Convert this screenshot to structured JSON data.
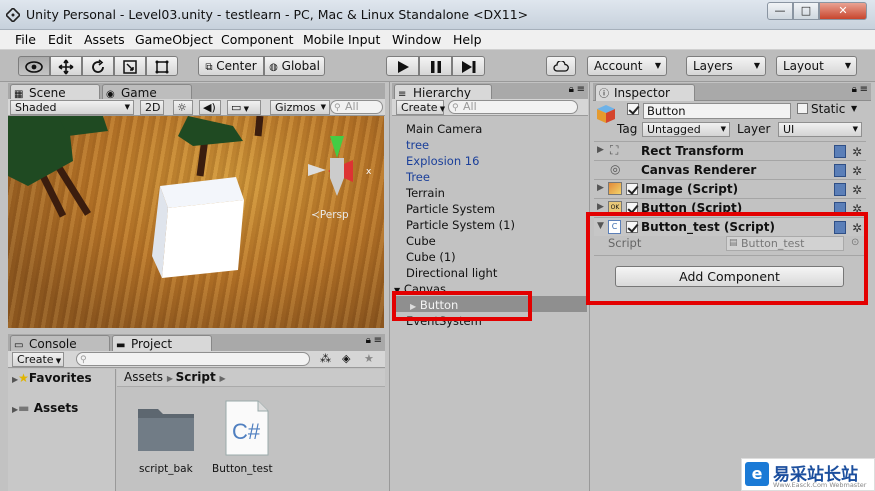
{
  "window": {
    "title": "Unity Personal - Level03.unity - testlearn - PC, Mac & Linux Standalone <DX11>",
    "min": "—",
    "max": "□",
    "close": "✕"
  },
  "menu": [
    "File",
    "Edit",
    "Assets",
    "GameObject",
    "Component",
    "Mobile Input",
    "Window",
    "Help"
  ],
  "toolbar": {
    "pivot": "Center",
    "space": "Global",
    "account": "Account",
    "layers": "Layers",
    "layout": "Layout"
  },
  "scene": {
    "tab_scene": "Scene",
    "tab_game": "Game",
    "shading": "Shaded",
    "mode_2d": "2D",
    "gizmos": "Gizmos",
    "search_placeholder": "All",
    "persp": "Persp",
    "axis_x": "x"
  },
  "hierarchy": {
    "tab": "Hierarchy",
    "create": "Create",
    "search_placeholder": "All",
    "items": [
      {
        "label": "Main Camera",
        "prefab": false
      },
      {
        "label": "tree",
        "prefab": true
      },
      {
        "label": "Explosion 16",
        "prefab": true
      },
      {
        "label": "Tree",
        "prefab": true
      },
      {
        "label": "Terrain",
        "prefab": false
      },
      {
        "label": "Particle System",
        "prefab": false
      },
      {
        "label": "Particle System (1)",
        "prefab": false
      },
      {
        "label": "Cube",
        "prefab": false
      },
      {
        "label": "Cube (1)",
        "prefab": false
      },
      {
        "label": "Directional light",
        "prefab": false
      },
      {
        "label": "Canvas",
        "prefab": false
      },
      {
        "label": "Button",
        "prefab": false
      },
      {
        "label": "EventSystem",
        "prefab": false
      }
    ],
    "selected": "Button"
  },
  "inspector": {
    "tab": "Inspector",
    "object_name": "Button",
    "static_label": "Static",
    "tag_label": "Tag",
    "tag_value": "Untagged",
    "layer_label": "Layer",
    "layer_value": "UI",
    "components": [
      {
        "name": "Rect Transform"
      },
      {
        "name": "Canvas Renderer"
      },
      {
        "name": "Image (Script)"
      },
      {
        "name": "Button (Script)"
      },
      {
        "name": "Button_test (Script)"
      }
    ],
    "script_label": "Script",
    "script_value": "Button_test",
    "add_component": "Add Component"
  },
  "console": {
    "tab_console": "Console",
    "tab_project": "Project",
    "create": "Create"
  },
  "project": {
    "favorites": "Favorites",
    "assets": "Assets",
    "breadcrumb_root": "Assets",
    "breadcrumb_current": "Script",
    "files": [
      {
        "name": "script_bak",
        "type": "folder"
      },
      {
        "name": "Button_test",
        "type": "csharp"
      }
    ]
  },
  "watermark": {
    "text": "易采站长站",
    "sub": "Www.Easck.Com Webmaster"
  },
  "colors": {
    "highlight": "#e30000",
    "prefab_text": "#1a3f9a",
    "selection": "#8f8f8f"
  }
}
